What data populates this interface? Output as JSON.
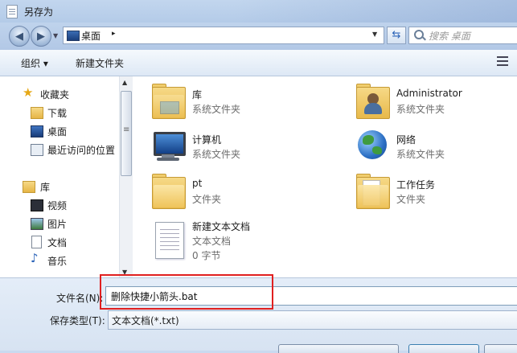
{
  "window": {
    "title": "另存为"
  },
  "address": {
    "location": "桌面",
    "separator": "▸"
  },
  "search": {
    "placeholder": "搜索 桌面"
  },
  "toolbar": {
    "organize_label": "组织 ▾",
    "new_folder_label": "新建文件夹"
  },
  "sidebar": {
    "items": [
      {
        "label": "收藏夹",
        "icon": "star-icon"
      },
      {
        "label": "下载",
        "icon": "download-folder-icon"
      },
      {
        "label": "桌面",
        "icon": "desktop-icon"
      },
      {
        "label": "最近访问的位置",
        "icon": "recent-places-icon"
      },
      {
        "label": "库",
        "icon": "library-icon"
      },
      {
        "label": "视频",
        "icon": "video-icon"
      },
      {
        "label": "图片",
        "icon": "picture-icon"
      },
      {
        "label": "文档",
        "icon": "document-icon"
      },
      {
        "label": "音乐",
        "icon": "music-icon"
      }
    ]
  },
  "files": [
    {
      "name": "库",
      "type": "系统文件夹",
      "icon": "library-folder-icon"
    },
    {
      "name": "Administrator",
      "type": "系统文件夹",
      "icon": "user-folder-icon"
    },
    {
      "name": "计算机",
      "type": "系统文件夹",
      "icon": "computer-icon"
    },
    {
      "name": "网络",
      "type": "系统文件夹",
      "icon": "network-globe-icon"
    },
    {
      "name": "pt",
      "type": "文件夹",
      "icon": "folder-icon"
    },
    {
      "name": "工作任务",
      "type": "文件夹",
      "icon": "folder-icon"
    },
    {
      "name": "新建文本文档",
      "type": "文本文档",
      "size": "0 字节",
      "icon": "text-file-icon"
    }
  ],
  "form": {
    "filename_label": "文件名(N):",
    "filename_value": "删除快捷小箭头.bat",
    "filetype_label": "保存类型(T):",
    "filetype_value": "文本文档(*.txt)"
  },
  "colors": {
    "highlight_box": "#e02020",
    "chrome": "#b9cfea"
  }
}
